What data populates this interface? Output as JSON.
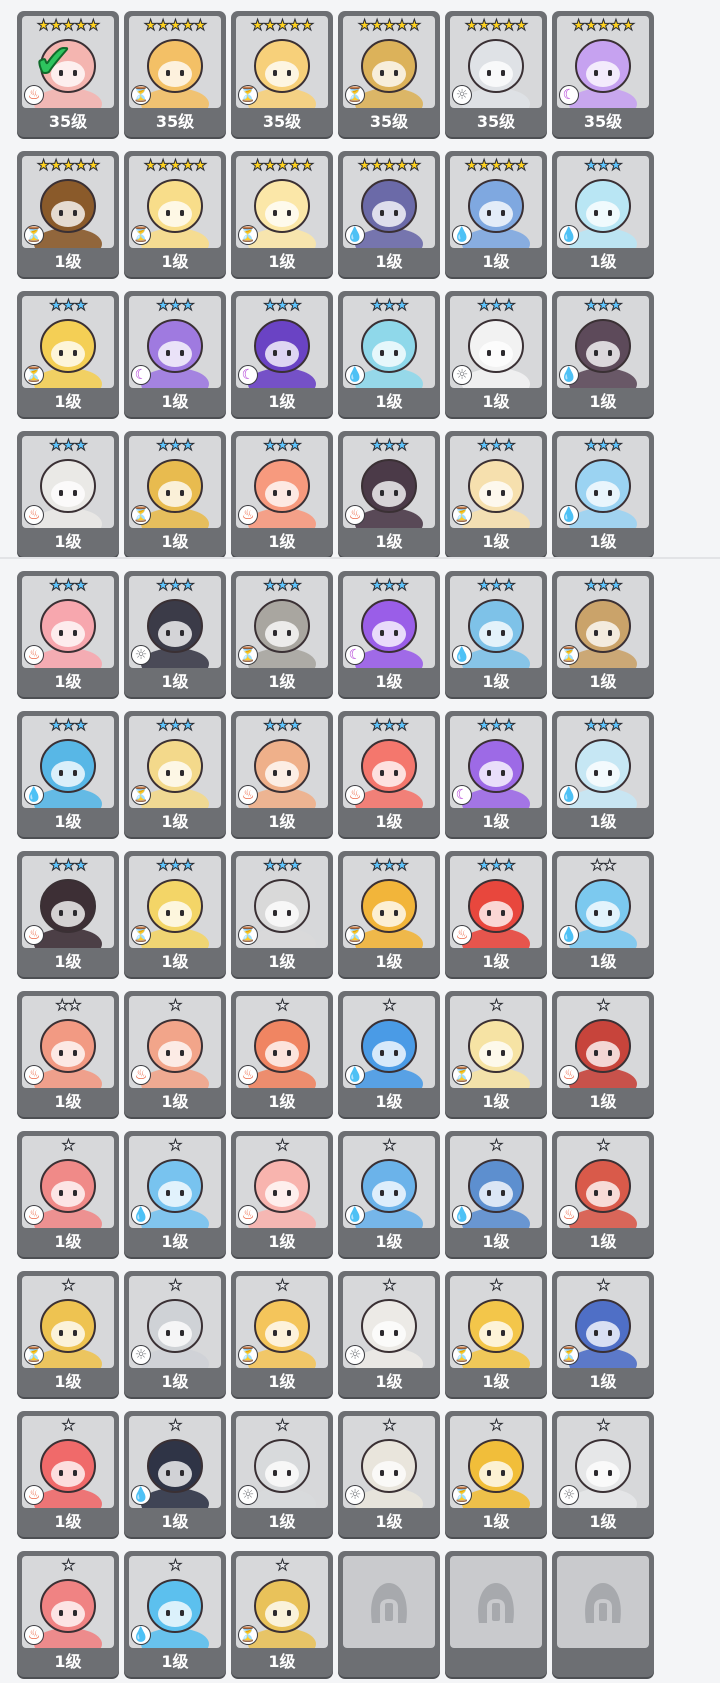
{
  "colors": {
    "card_frame": "#6d6f73",
    "portrait_bg": "#d7d8da",
    "star_gold": "#ffd21f",
    "star_blue": "#5fc6ff",
    "star_silver": "#e6e8ec",
    "fire": "#e8502b",
    "water": "#2b86d8",
    "earth": "#f1a21a",
    "light": "#7a7c80",
    "dark": "#b03ad6"
  },
  "heroes": [
    {
      "level_label": "35级",
      "stars": 5,
      "star_color": "gold",
      "element": "fire",
      "hue": "#f4b5b0",
      "selected": true,
      "locked": false
    },
    {
      "level_label": "35级",
      "stars": 5,
      "star_color": "gold",
      "element": "earth",
      "hue": "#f3c066",
      "selected": false,
      "locked": false
    },
    {
      "level_label": "35级",
      "stars": 5,
      "star_color": "gold",
      "element": "earth",
      "hue": "#f7d07a",
      "selected": false,
      "locked": false
    },
    {
      "level_label": "35级",
      "stars": 5,
      "star_color": "gold",
      "element": "earth",
      "hue": "#dcb25a",
      "selected": false,
      "locked": false
    },
    {
      "level_label": "35级",
      "stars": 5,
      "star_color": "gold",
      "element": "light",
      "hue": "#dfe2e6",
      "selected": false,
      "locked": false
    },
    {
      "level_label": "35级",
      "stars": 5,
      "star_color": "gold",
      "element": "dark",
      "hue": "#c6a2f0",
      "selected": false,
      "locked": false
    },
    {
      "level_label": "1级",
      "stars": 5,
      "star_color": "gold",
      "element": "earth",
      "hue": "#8a5a2a",
      "selected": false,
      "locked": false
    },
    {
      "level_label": "1级",
      "stars": 5,
      "star_color": "gold",
      "element": "earth",
      "hue": "#f8dd8a",
      "selected": false,
      "locked": false
    },
    {
      "level_label": "1级",
      "stars": 5,
      "star_color": "gold",
      "element": "earth",
      "hue": "#fbe7a8",
      "selected": false,
      "locked": false
    },
    {
      "level_label": "1级",
      "stars": 5,
      "star_color": "gold",
      "element": "water",
      "hue": "#6b6aa8",
      "selected": false,
      "locked": false
    },
    {
      "level_label": "1级",
      "stars": 5,
      "star_color": "gold",
      "element": "water",
      "hue": "#7fa8e0",
      "selected": false,
      "locked": false
    },
    {
      "level_label": "1级",
      "stars": 3,
      "star_color": "blue",
      "element": "water",
      "hue": "#b9e6f4",
      "selected": false,
      "locked": false
    },
    {
      "level_label": "1级",
      "stars": 3,
      "star_color": "blue",
      "element": "earth",
      "hue": "#f4cf55",
      "selected": false,
      "locked": false
    },
    {
      "level_label": "1级",
      "stars": 3,
      "star_color": "blue",
      "element": "dark",
      "hue": "#9f7ae0",
      "selected": false,
      "locked": false
    },
    {
      "level_label": "1级",
      "stars": 3,
      "star_color": "blue",
      "element": "dark",
      "hue": "#6a43c4",
      "selected": false,
      "locked": false
    },
    {
      "level_label": "1级",
      "stars": 3,
      "star_color": "blue",
      "element": "water",
      "hue": "#8fd8ea",
      "selected": false,
      "locked": false
    },
    {
      "level_label": "1级",
      "stars": 3,
      "star_color": "blue",
      "element": "light",
      "hue": "#f2f2f2",
      "selected": false,
      "locked": false
    },
    {
      "level_label": "1级",
      "stars": 3,
      "star_color": "blue",
      "element": "water",
      "hue": "#5d4a5a",
      "selected": false,
      "locked": false
    },
    {
      "level_label": "1级",
      "stars": 3,
      "star_color": "blue",
      "element": "fire",
      "hue": "#eae9e6",
      "selected": false,
      "locked": false
    },
    {
      "level_label": "1级",
      "stars": 3,
      "star_color": "blue",
      "element": "earth",
      "hue": "#e8bb4f",
      "selected": false,
      "locked": false
    },
    {
      "level_label": "1级",
      "stars": 3,
      "star_color": "blue",
      "element": "fire",
      "hue": "#f79a7e",
      "selected": false,
      "locked": false
    },
    {
      "level_label": "1级",
      "stars": 3,
      "star_color": "blue",
      "element": "fire",
      "hue": "#4b3a48",
      "selected": false,
      "locked": false
    },
    {
      "level_label": "1级",
      "stars": 3,
      "star_color": "blue",
      "element": "earth",
      "hue": "#f6e0ae",
      "selected": false,
      "locked": false
    },
    {
      "level_label": "1级",
      "stars": 3,
      "star_color": "blue",
      "element": "water",
      "hue": "#9bd3f2",
      "selected": false,
      "locked": false
    },
    {
      "level_label": "1级",
      "stars": 3,
      "star_color": "blue",
      "element": "fire",
      "hue": "#f7a7ae",
      "selected": false,
      "locked": false
    },
    {
      "level_label": "1级",
      "stars": 3,
      "star_color": "blue",
      "element": "light",
      "hue": "#3b3b48",
      "selected": false,
      "locked": false
    },
    {
      "level_label": "1级",
      "stars": 3,
      "star_color": "blue",
      "element": "earth",
      "hue": "#a9a6a0",
      "selected": false,
      "locked": false
    },
    {
      "level_label": "1级",
      "stars": 3,
      "star_color": "blue",
      "element": "dark",
      "hue": "#9a5ee8",
      "selected": false,
      "locked": false
    },
    {
      "level_label": "1级",
      "stars": 3,
      "star_color": "blue",
      "element": "water",
      "hue": "#7ec2e8",
      "selected": false,
      "locked": false
    },
    {
      "level_label": "1级",
      "stars": 3,
      "star_color": "blue",
      "element": "earth",
      "hue": "#caa36a",
      "selected": false,
      "locked": false
    },
    {
      "level_label": "1级",
      "stars": 3,
      "star_color": "blue",
      "element": "water",
      "hue": "#58b7e6",
      "selected": false,
      "locked": false
    },
    {
      "level_label": "1级",
      "stars": 3,
      "star_color": "blue",
      "element": "earth",
      "hue": "#f3d98b",
      "selected": false,
      "locked": false
    },
    {
      "level_label": "1级",
      "stars": 3,
      "star_color": "blue",
      "element": "fire",
      "hue": "#efb08a",
      "selected": false,
      "locked": false
    },
    {
      "level_label": "1级",
      "stars": 3,
      "star_color": "blue",
      "element": "fire",
      "hue": "#f4776d",
      "selected": false,
      "locked": false
    },
    {
      "level_label": "1级",
      "stars": 3,
      "star_color": "blue",
      "element": "dark",
      "hue": "#9d6ae6",
      "selected": false,
      "locked": false
    },
    {
      "level_label": "1级",
      "stars": 3,
      "star_color": "blue",
      "element": "water",
      "hue": "#c6e7f4",
      "selected": false,
      "locked": false
    },
    {
      "level_label": "1级",
      "stars": 3,
      "star_color": "blue",
      "element": "fire",
      "hue": "#3d2f35",
      "selected": false,
      "locked": false
    },
    {
      "level_label": "1级",
      "stars": 3,
      "star_color": "blue",
      "element": "earth",
      "hue": "#f3d567",
      "selected": false,
      "locked": false
    },
    {
      "level_label": "1级",
      "stars": 3,
      "star_color": "blue",
      "element": "earth",
      "hue": "#d9d9d9",
      "selected": false,
      "locked": false
    },
    {
      "level_label": "1级",
      "stars": 3,
      "star_color": "blue",
      "element": "earth",
      "hue": "#f2b53a",
      "selected": false,
      "locked": false
    },
    {
      "level_label": "1级",
      "stars": 3,
      "star_color": "blue",
      "element": "fire",
      "hue": "#e8473d",
      "selected": false,
      "locked": false
    },
    {
      "level_label": "1级",
      "stars": 2,
      "star_color": "silver",
      "element": "water",
      "hue": "#7cc9ef",
      "selected": false,
      "locked": false
    },
    {
      "level_label": "1级",
      "stars": 2,
      "star_color": "silver",
      "element": "fire",
      "hue": "#f29a83",
      "selected": false,
      "locked": false
    },
    {
      "level_label": "1级",
      "stars": 1,
      "star_color": "silver",
      "element": "fire",
      "hue": "#f2a58a",
      "selected": false,
      "locked": false
    },
    {
      "level_label": "1级",
      "stars": 1,
      "star_color": "silver",
      "element": "fire",
      "hue": "#f08562",
      "selected": false,
      "locked": false
    },
    {
      "level_label": "1级",
      "stars": 1,
      "star_color": "silver",
      "element": "water",
      "hue": "#4a9be6",
      "selected": false,
      "locked": false
    },
    {
      "level_label": "1级",
      "stars": 1,
      "star_color": "silver",
      "element": "earth",
      "hue": "#f6e3a4",
      "selected": false,
      "locked": false
    },
    {
      "level_label": "1级",
      "stars": 1,
      "star_color": "silver",
      "element": "fire",
      "hue": "#c7443b",
      "selected": false,
      "locked": false
    },
    {
      "level_label": "1级",
      "stars": 1,
      "star_color": "silver",
      "element": "fire",
      "hue": "#f08a88",
      "selected": false,
      "locked": false
    },
    {
      "level_label": "1级",
      "stars": 1,
      "star_color": "silver",
      "element": "water",
      "hue": "#78c3ef",
      "selected": false,
      "locked": false
    },
    {
      "level_label": "1级",
      "stars": 1,
      "star_color": "silver",
      "element": "fire",
      "hue": "#f8b4ae",
      "selected": false,
      "locked": false
    },
    {
      "level_label": "1级",
      "stars": 1,
      "star_color": "silver",
      "element": "water",
      "hue": "#6bb3ea",
      "selected": false,
      "locked": false
    },
    {
      "level_label": "1级",
      "stars": 1,
      "star_color": "silver",
      "element": "water",
      "hue": "#5d8fcf",
      "selected": false,
      "locked": false
    },
    {
      "level_label": "1级",
      "stars": 1,
      "star_color": "silver",
      "element": "fire",
      "hue": "#d95a4a",
      "selected": false,
      "locked": false
    },
    {
      "level_label": "1级",
      "stars": 1,
      "star_color": "silver",
      "element": "earth",
      "hue": "#eec351",
      "selected": false,
      "locked": false
    },
    {
      "level_label": "1级",
      "stars": 1,
      "star_color": "silver",
      "element": "light",
      "hue": "#cfd2d6",
      "selected": false,
      "locked": false
    },
    {
      "level_label": "1级",
      "stars": 1,
      "star_color": "silver",
      "element": "earth",
      "hue": "#f4c55b",
      "selected": false,
      "locked": false
    },
    {
      "level_label": "1级",
      "stars": 1,
      "star_color": "silver",
      "element": "light",
      "hue": "#eceae6",
      "selected": false,
      "locked": false
    },
    {
      "level_label": "1级",
      "stars": 1,
      "star_color": "silver",
      "element": "earth",
      "hue": "#f3c64a",
      "selected": false,
      "locked": false
    },
    {
      "level_label": "1级",
      "stars": 1,
      "star_color": "silver",
      "element": "earth",
      "hue": "#4f6fc6",
      "selected": false,
      "locked": false
    },
    {
      "level_label": "1级",
      "stars": 1,
      "star_color": "silver",
      "element": "fire",
      "hue": "#f06a6a",
      "selected": false,
      "locked": false
    },
    {
      "level_label": "1级",
      "stars": 1,
      "star_color": "silver",
      "element": "water",
      "hue": "#2f3446",
      "selected": false,
      "locked": false
    },
    {
      "level_label": "1级",
      "stars": 1,
      "star_color": "silver",
      "element": "light",
      "hue": "#d8dadc",
      "selected": false,
      "locked": false
    },
    {
      "level_label": "1级",
      "stars": 1,
      "star_color": "silver",
      "element": "light",
      "hue": "#e9e5dc",
      "selected": false,
      "locked": false
    },
    {
      "level_label": "1级",
      "stars": 1,
      "star_color": "silver",
      "element": "earth",
      "hue": "#f1be3a",
      "selected": false,
      "locked": false
    },
    {
      "level_label": "1级",
      "stars": 1,
      "star_color": "silver",
      "element": "light",
      "hue": "#e6e7e8",
      "selected": false,
      "locked": false
    },
    {
      "level_label": "1级",
      "stars": 1,
      "star_color": "silver",
      "element": "fire",
      "hue": "#f08383",
      "selected": false,
      "locked": false
    },
    {
      "level_label": "1级",
      "stars": 1,
      "star_color": "silver",
      "element": "water",
      "hue": "#5cc0ee",
      "selected": false,
      "locked": false
    },
    {
      "level_label": "1级",
      "stars": 1,
      "star_color": "silver",
      "element": "earth",
      "hue": "#e9c25a",
      "selected": false,
      "locked": false
    },
    {
      "level_label": "",
      "stars": 0,
      "star_color": "silver",
      "element": "",
      "hue": "#c9cacd",
      "selected": false,
      "locked": true
    },
    {
      "level_label": "",
      "stars": 0,
      "star_color": "silver",
      "element": "",
      "hue": "#c9cacd",
      "selected": false,
      "locked": true
    },
    {
      "level_label": "",
      "stars": 0,
      "star_color": "silver",
      "element": "",
      "hue": "#c9cacd",
      "selected": false,
      "locked": true
    }
  ]
}
